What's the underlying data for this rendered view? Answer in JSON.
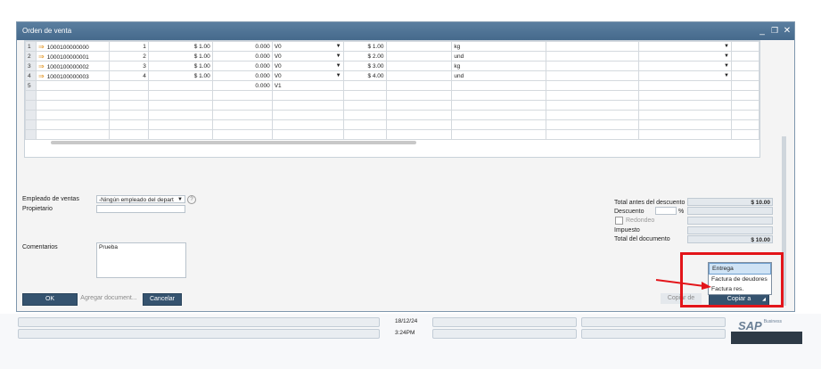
{
  "window": {
    "title": "Orden de venta",
    "controls": [
      "minimize-icon",
      "restore-icon",
      "close-icon"
    ]
  },
  "grid": {
    "rows": [
      {
        "n": "1",
        "code": "1000100000000",
        "qty": "1",
        "price": "$ 1.00",
        "disc": "0.000",
        "tax": "V0",
        "total": "$ 1.00",
        "uom": "kg"
      },
      {
        "n": "2",
        "code": "1000100000001",
        "qty": "2",
        "price": "$ 1.00",
        "disc": "0.000",
        "tax": "V0",
        "total": "$ 2.00",
        "uom": "und"
      },
      {
        "n": "3",
        "code": "1000100000002",
        "qty": "3",
        "price": "$ 1.00",
        "disc": "0.000",
        "tax": "V0",
        "total": "$ 3.00",
        "uom": "kg"
      },
      {
        "n": "4",
        "code": "1000100000003",
        "qty": "4",
        "price": "$ 1.00",
        "disc": "0.000",
        "tax": "V0",
        "total": "$ 4.00",
        "uom": "und"
      },
      {
        "n": "5",
        "code": "",
        "qty": "",
        "price": "",
        "disc": "0.000",
        "tax": "V1",
        "total": "",
        "uom": ""
      }
    ]
  },
  "form": {
    "empleado_label": "Empleado de ventas",
    "empleado_value": "-Ningún empleado del depart",
    "propietario_label": "Propietario",
    "propietario_value": "",
    "comentarios_label": "Comentarios",
    "comentarios_value": "Prueba"
  },
  "totals": {
    "total_antes_label": "Total antes del descuento",
    "total_antes_value": "$ 10.00",
    "descuento_label": "Descuento",
    "descuento_percent": "%",
    "redondeo_label": "Redondeo",
    "impuesto_label": "Impuesto",
    "total_doc_label": "Total del documento",
    "total_doc_value": "$ 10.00"
  },
  "buttons": {
    "ok": "OK",
    "agregar": "Agregar document...",
    "cancelar": "Cancelar",
    "copiar_de": "Copiar de",
    "copiar_a": "Copiar a"
  },
  "copy_menu": {
    "items": [
      "Entrega",
      "Factura de deudores",
      "Factura res."
    ],
    "highlighted": "Entrega"
  },
  "status": {
    "date": "18/12/24",
    "time": "3:24PM"
  },
  "brand": {
    "logo_text": "SAP",
    "logo_sub": "Business"
  },
  "colors": {
    "titlebar": "#45698c",
    "button": "#35536f",
    "highlight": "#e3151a"
  }
}
